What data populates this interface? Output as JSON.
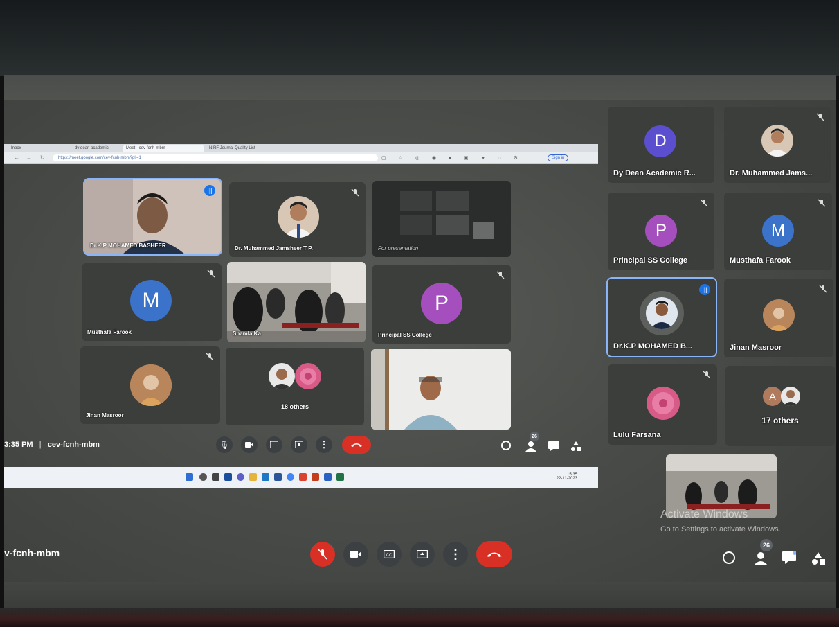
{
  "colors": {
    "accent_blue": "#8ab4f8",
    "end_red": "#d93025",
    "avatar_dean": "#5b4fcf",
    "avatar_principal": "#a54fbe",
    "avatar_musthafa": "#3a73c9"
  },
  "inner_browser": {
    "tabs": [
      "Inbox",
      "dy dean academic",
      "Meet - cev-fcnh-mbm",
      "NIRF Journal Quality List"
    ],
    "url": "https://meet.google.com/cev-fcnh-mbm?pli=1",
    "signin": "Sign in"
  },
  "inner_grid": {
    "tiles": [
      {
        "name": "Dr.K.P MOHAMED BASHEER"
      },
      {
        "name": "Dr. Muhammed Jamsheer T P."
      },
      {
        "name": "For presentation"
      },
      {
        "name": "Musthafa Farook",
        "letter": "M"
      },
      {
        "name": "Shamla Ka"
      },
      {
        "name": "Principal SS College",
        "letter": "P"
      },
      {
        "name": "Jinan Masroor"
      },
      {
        "name": "18 others"
      }
    ]
  },
  "inner_controls": {
    "time_code": "3:35 PM",
    "separator": "|",
    "meeting_code": "cev-fcnh-mbm",
    "people_count": "26"
  },
  "inner_taskbar": {
    "clock_time": "15:35",
    "clock_date": "22-11-2023"
  },
  "outer_sidebar": {
    "tiles": [
      {
        "name": "Dy Dean Academic R...",
        "letter": "D"
      },
      {
        "name": "Dr. Muhammed Jams..."
      },
      {
        "name": "Principal SS College",
        "letter": "P"
      },
      {
        "name": "Musthafa Farook",
        "letter": "M"
      },
      {
        "name": "Dr.K.P MOHAMED B..."
      },
      {
        "name": "Jinan Masroor"
      },
      {
        "name": "Lulu Farsana"
      },
      {
        "name": "17 others",
        "letter": "A"
      }
    ]
  },
  "outer_controls": {
    "meeting_code": "v-fcnh-mbm",
    "people_count": "26"
  },
  "activate_windows": {
    "title": "Activate Windows",
    "subtitle": "Go to Settings to activate Windows."
  }
}
